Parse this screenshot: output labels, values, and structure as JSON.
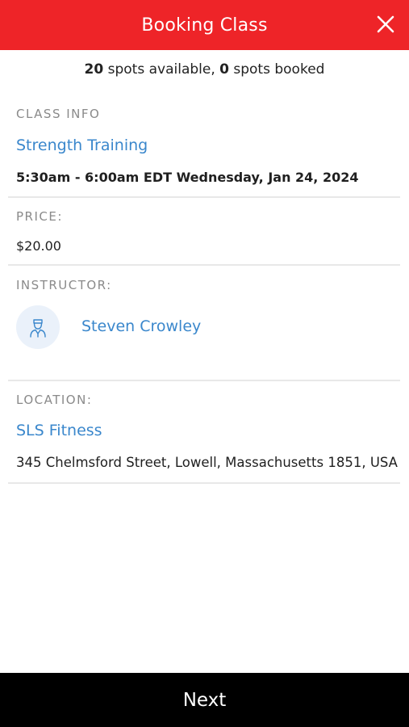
{
  "header": {
    "title": "Booking Class",
    "close_icon": "close-icon",
    "color": "#ee2428"
  },
  "availability": {
    "spots_available": "20",
    "spots_available_text": " spots available, ",
    "spots_booked": "0",
    "spots_booked_text": " spots booked"
  },
  "class_info": {
    "label": "CLASS INFO",
    "name": "Strength Training",
    "datetime": "5:30am - 6:00am EDT Wednesday, Jan 24, 2024"
  },
  "price": {
    "label": "PRICE:",
    "value": "$20.00"
  },
  "instructor": {
    "label": "INSTRUCTOR:",
    "name": "Steven Crowley",
    "avatar_icon": "person-icon"
  },
  "location": {
    "label": "LOCATION:",
    "name": "SLS Fitness",
    "address": "345 Chelmsford Street, Lowell, Massachusetts 1851, USA"
  },
  "footer": {
    "next_label": "Next"
  },
  "colors": {
    "accent_red": "#ee2428",
    "link_blue": "#3a87cc",
    "footer_black": "#000000"
  }
}
